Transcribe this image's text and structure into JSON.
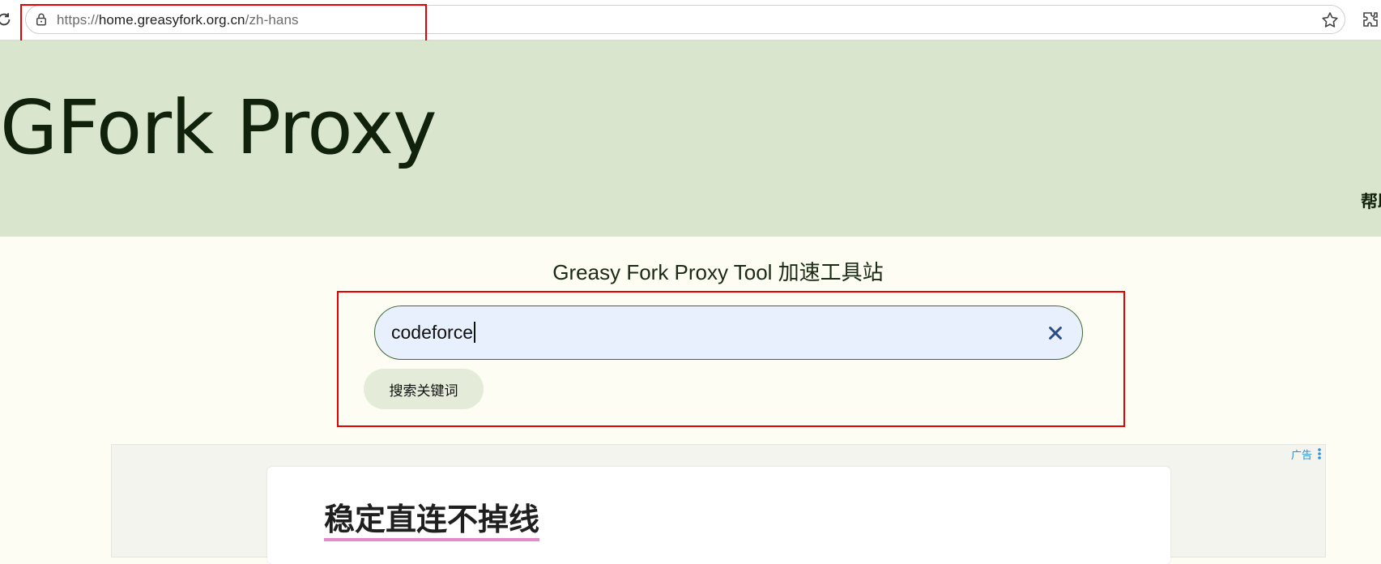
{
  "browser": {
    "url_prefix": "https://",
    "url_host": "home.greasyfork.org.cn",
    "url_path": "/zh-hans"
  },
  "header": {
    "site_title": "GFork Proxy",
    "nav_help": "帮助"
  },
  "main": {
    "subtitle": "Greasy Fork Proxy Tool 加速工具站",
    "search_value": "codeforce",
    "search_button": "搜索关键词"
  },
  "ad": {
    "badge": "广告",
    "headline": "稳定直连不掉线"
  },
  "colors": {
    "header_bg": "#d9e6cd",
    "page_bg": "#fefdf3",
    "input_bg": "#e8f0fe",
    "highlight": "#e60000",
    "accent_underline": "#e38acb"
  }
}
